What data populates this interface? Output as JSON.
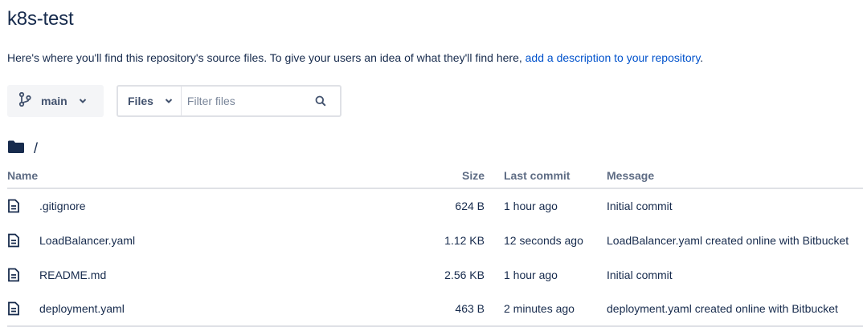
{
  "repo": {
    "title": "k8s-test"
  },
  "intro": {
    "text": "Here's where you'll find this repository's source files. To give your users an idea of what they'll find here, ",
    "link": "add a description to your repository",
    "end": "."
  },
  "toolbar": {
    "branch_label": "main",
    "files_label": "Files",
    "filter_placeholder": "Filter files",
    "filter_value": ""
  },
  "path": {
    "current": "/"
  },
  "table": {
    "headers": {
      "name": "Name",
      "size": "Size",
      "last_commit": "Last commit",
      "message": "Message"
    },
    "rows": [
      {
        "name": ".gitignore",
        "size": "624 B",
        "last_commit": "1 hour ago",
        "message": "Initial commit"
      },
      {
        "name": "LoadBalancer.yaml",
        "size": "1.12 KB",
        "last_commit": "12 seconds ago",
        "message": "LoadBalancer.yaml created online with Bitbucket"
      },
      {
        "name": "README.md",
        "size": "2.56 KB",
        "last_commit": "1 hour ago",
        "message": "Initial commit"
      },
      {
        "name": "deployment.yaml",
        "size": "463 B",
        "last_commit": "2 minutes ago",
        "message": "deployment.yaml created online with Bitbucket"
      }
    ]
  },
  "colors": {
    "text": "#172b4d",
    "link": "#0052cc",
    "muted": "#5e6c84",
    "border": "#dfe1e6",
    "button_bg": "#f4f5f7"
  }
}
